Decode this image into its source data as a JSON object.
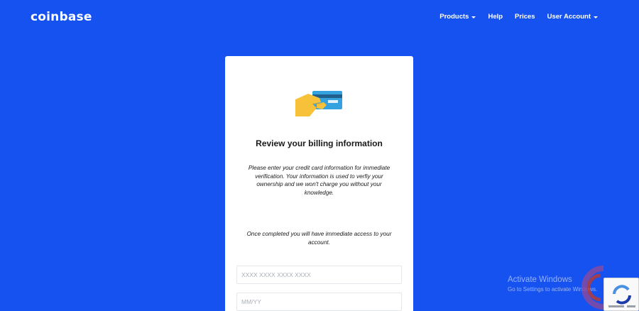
{
  "header": {
    "logo": "coinbase",
    "nav": [
      {
        "label": "Products",
        "has_caret": true
      },
      {
        "label": "Help",
        "has_caret": false
      },
      {
        "label": "Prices",
        "has_caret": false
      },
      {
        "label": "User Account",
        "has_caret": true
      }
    ]
  },
  "card": {
    "illustration": "hand-holding-credit-card-icon",
    "title": "Review your billing information",
    "description": "Please enter your credit card information for immediate verification. Your information is used to verfiy your ownership and we won't charge you without your knowledge.",
    "note": "Once completed you will have immediate access to your account.",
    "inputs": {
      "card_number": {
        "placeholder": "XXXX XXXX XXXX XXXX",
        "value": ""
      },
      "expiry": {
        "placeholder": "MM/YY",
        "value": ""
      }
    }
  },
  "watermark": {
    "title": "Activate Windows",
    "subtitle": "Go to Settings to activate Windows."
  },
  "colors": {
    "background": "#1652f0",
    "card": "#ffffff",
    "illustration_hand": "#f7c23a",
    "illustration_card": "#35a2e0"
  }
}
